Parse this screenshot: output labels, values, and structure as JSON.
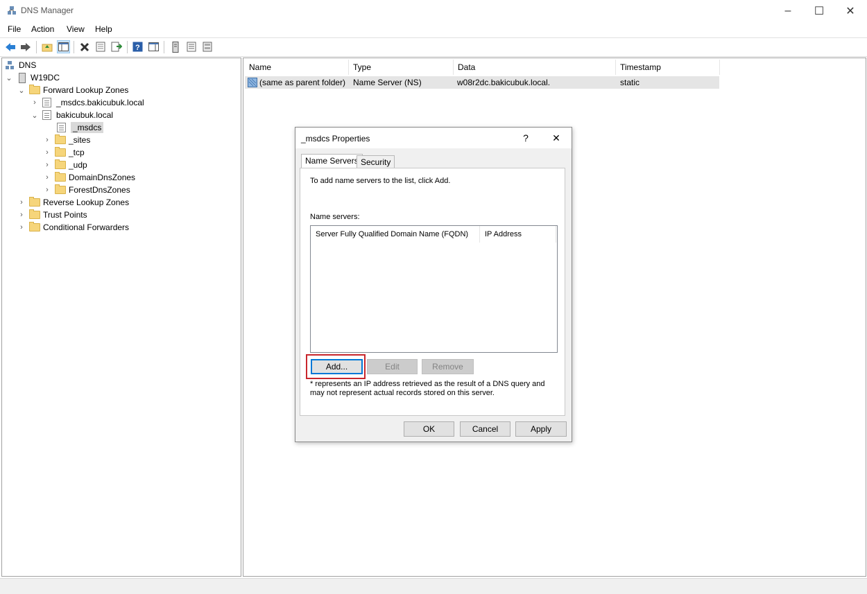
{
  "window": {
    "title": "DNS Manager"
  },
  "menu": [
    "File",
    "Action",
    "View",
    "Help"
  ],
  "tree": {
    "root": "DNS",
    "server": "W19DC",
    "forward": "Forward Lookup Zones",
    "msdcs_zone": "_msdcs.bakicubuk.local",
    "domain": "bakicubuk.local",
    "msdcs": "_msdcs",
    "sites": "_sites",
    "tcp": "_tcp",
    "udp": "_udp",
    "domaindns": "DomainDnsZones",
    "forestdns": "ForestDnsZones",
    "reverse": "Reverse Lookup Zones",
    "trust": "Trust Points",
    "conditional": "Conditional Forwarders"
  },
  "records": {
    "columns": [
      "Name",
      "Type",
      "Data",
      "Timestamp"
    ],
    "rows": [
      {
        "name": "(same as parent folder)",
        "type": "Name Server (NS)",
        "data": "w08r2dc.bakicubuk.local.",
        "timestamp": "static"
      }
    ]
  },
  "dialog": {
    "title": "_msdcs Properties",
    "help": "?",
    "tabs": [
      "Name Servers",
      "Security"
    ],
    "intro": "To add name servers to the list, click Add.",
    "list_label": "Name servers:",
    "list_columns": [
      "Server Fully Qualified Domain Name (FQDN)",
      "IP Address"
    ],
    "buttons": {
      "add": "Add...",
      "edit": "Edit",
      "remove": "Remove"
    },
    "note": "* represents an IP address retrieved as the result of a DNS query and may not represent actual records stored on this server.",
    "footer": {
      "ok": "OK",
      "cancel": "Cancel",
      "apply": "Apply"
    }
  },
  "colors": {
    "highlight": "#c8262c",
    "accent": "#0078d7"
  }
}
